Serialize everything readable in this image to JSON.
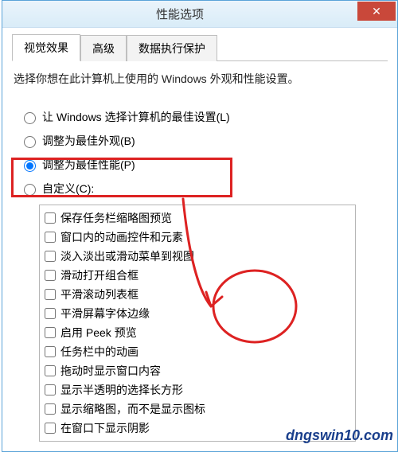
{
  "window": {
    "title": "性能选项",
    "close_glyph": "✕"
  },
  "tabs": {
    "t0": "视觉效果",
    "t1": "高级",
    "t2": "数据执行保护"
  },
  "description": "选择你想在此计算机上使用的 Windows 外观和性能设置。",
  "radios": {
    "r0": "让 Windows 选择计算机的最佳设置(L)",
    "r1": "调整为最佳外观(B)",
    "r2": "调整为最佳性能(P)",
    "r3": "自定义(C):"
  },
  "checks": {
    "c0": "保存任务栏缩略图预览",
    "c1": "窗口内的动画控件和元素",
    "c2": "淡入淡出或滑动菜单到视图",
    "c3": "滑动打开组合框",
    "c4": "平滑滚动列表框",
    "c5": "平滑屏幕字体边缘",
    "c6": "启用 Peek 预览",
    "c7": "任务栏中的动画",
    "c8": "拖动时显示窗口内容",
    "c9": "显示半透明的选择长方形",
    "c10": "显示缩略图，而不是显示图标",
    "c11": "在窗口下显示阴影"
  },
  "watermark": "dngswin10.com"
}
